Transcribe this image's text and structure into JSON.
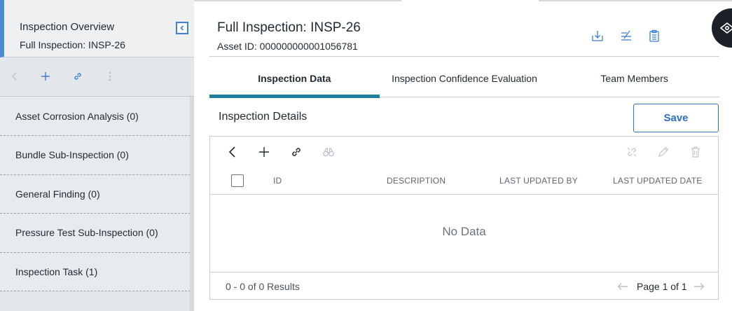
{
  "sidebar": {
    "title": "Inspection Overview",
    "subtitle": "Full Inspection: INSP-26",
    "toolbar": {
      "icons": [
        "chevron-left-icon",
        "plus-icon",
        "link-icon",
        "more-vertical-icon"
      ]
    },
    "items": [
      {
        "label": "Asset Corrosion Analysis (0)"
      },
      {
        "label": "Bundle Sub-Inspection (0)"
      },
      {
        "label": "General Finding (0)"
      },
      {
        "label": "Pressure Test Sub-Inspection (0)"
      },
      {
        "label": "Inspection Task (1)"
      }
    ]
  },
  "header": {
    "title": "Full Inspection: INSP-26",
    "asset_id": "Asset ID: 000000000001056781",
    "tools": [
      "download-icon",
      "compare-icon",
      "clipboard-icon"
    ]
  },
  "tabs": [
    {
      "label": "Inspection Data",
      "active": true
    },
    {
      "label": "Inspection Confidence Evaluation",
      "active": false
    },
    {
      "label": "Team Members",
      "active": false
    }
  ],
  "section": {
    "title": "Inspection Details",
    "save_label": "Save"
  },
  "grid": {
    "columns": [
      "ID",
      "DESCRIPTION",
      "LAST UPDATED BY",
      "LAST UPDATED DATE"
    ],
    "rows": [],
    "empty_text": "No Data",
    "results_text": "0 - 0 of 0 Results",
    "page_text": "Page 1 of 1"
  },
  "colors": {
    "accent": "#1e7f9c",
    "primary": "#2f6fbf",
    "sidebar_accent": "#4a8fd6"
  }
}
